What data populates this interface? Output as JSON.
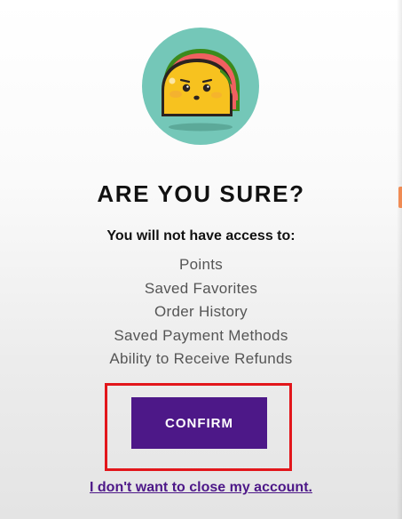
{
  "illustration": {
    "name": "taco-icon",
    "circle_color": "#74c7b8"
  },
  "dialog": {
    "title": "ARE YOU SURE?",
    "subtitle": "You will not have access to:",
    "benefits": [
      "Points",
      "Saved Favorites",
      "Order History",
      "Saved Payment Methods",
      "Ability to Receive Refunds"
    ],
    "confirm_label": "CONFIRM",
    "decline_label": "I don't want to close my account."
  },
  "colors": {
    "primary": "#4d1888",
    "highlight": "#e2161b",
    "text": "#111111",
    "muted_text": "#555555"
  }
}
